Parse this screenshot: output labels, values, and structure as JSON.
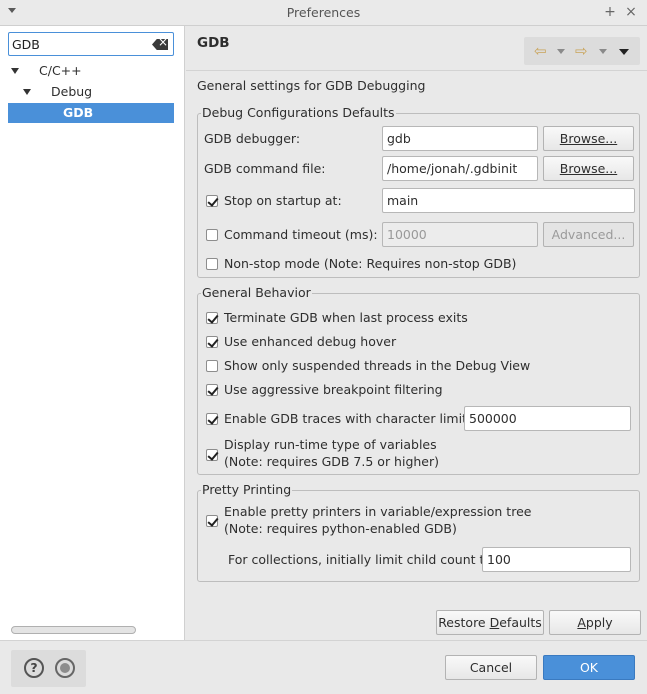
{
  "window": {
    "title": "Preferences",
    "minimize_glyph": "+",
    "close_glyph": "×"
  },
  "sidebar": {
    "filter_value": "GDB",
    "tree": [
      {
        "label": "C/C++"
      },
      {
        "label": "Debug"
      },
      {
        "label": "GDB"
      }
    ]
  },
  "page": {
    "title": "GDB",
    "description": "General settings for GDB Debugging",
    "nav": {
      "back_glyph": "⇦",
      "forward_glyph": "⇨"
    }
  },
  "debug_defaults": {
    "legend": "Debug Configurations Defaults",
    "gdb_debugger_label": "GDB debugger:",
    "gdb_debugger_value": "gdb",
    "browse_label": "Browse...",
    "gdb_command_file_label": "GDB command file:",
    "gdb_command_file_value": "/home/jonah/.gdbinit",
    "stop_on_startup_label": "Stop on startup at:",
    "stop_on_startup_value": "main",
    "command_timeout_label": "Command timeout (ms):",
    "command_timeout_value": "10000",
    "advanced_label": "Advanced...",
    "non_stop_label": "Non-stop mode (Note: Requires non-stop GDB)"
  },
  "general_behavior": {
    "legend": "General Behavior",
    "terminate_label": "Terminate GDB when last process exits",
    "enhanced_hover_label": "Use enhanced debug hover",
    "suspended_threads_label": "Show only suspended threads in the Debug View",
    "aggressive_bp_label": "Use aggressive breakpoint filtering",
    "traces_label": "Enable GDB traces with character limit:",
    "traces_value": "500000",
    "runtime_type_line1": "Display run-time type of variables",
    "runtime_type_line2": "(Note: requires GDB 7.5 or higher)"
  },
  "pretty_printing": {
    "legend": "Pretty Printing",
    "enable_line1": "Enable pretty printers in variable/expression tree",
    "enable_line2": "(Note: requires python-enabled GDB)",
    "child_limit_label": "For collections, initially limit child count to",
    "child_limit_value": "100"
  },
  "actions": {
    "restore_defaults_pre": "Restore ",
    "restore_defaults_mn": "D",
    "restore_defaults_post": "efaults",
    "apply_mn": "A",
    "apply_post": "pply",
    "help_glyph": "?",
    "cancel": "Cancel",
    "ok": "OK"
  }
}
